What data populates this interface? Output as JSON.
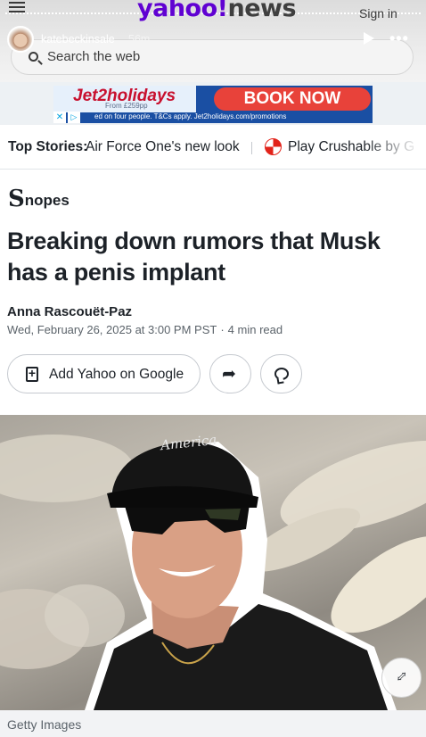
{
  "header": {
    "logo_brand": "yahoo!",
    "logo_section": "news",
    "signin_label": "Sign in"
  },
  "story_overlay": {
    "username": "katebeckinsale",
    "time_ago": "56m"
  },
  "search": {
    "placeholder": "Search the web"
  },
  "ad": {
    "logo_text": "Jet2holidays",
    "price_text": "From £259pp",
    "cta_label": "BOOK NOW",
    "terms_text": "ed on four people. T&Cs apply. Jet2holidays.com/promotions"
  },
  "top_stories": {
    "label": "Top Stories:",
    "items": [
      "Air Force One's new look",
      "Play Crushable by G"
    ]
  },
  "article": {
    "source_glyph": "S",
    "source_word": "nopes",
    "title": "Breaking down rumors that Musk has a penis implant",
    "author": "Anna Rascouët-Paz",
    "date": "Wed, February 26, 2025 at 3:00 PM PST",
    "separator": "·",
    "read_time": "4 min read"
  },
  "actions": {
    "google_label": "Add Yahoo on Google"
  },
  "hero": {
    "cap_text": "America",
    "photo_credit": "Getty Images"
  },
  "icons": {
    "hamburger": "hamburger-menu-icon",
    "search": "search-icon",
    "play": "play-icon",
    "more": "more-horizontal-icon",
    "add": "add-bookmark-icon",
    "share": "share-arrow-icon",
    "comment": "comment-bubble-icon",
    "zoom": "expand-icon"
  },
  "colors": {
    "yahoo_purple": "#6001d2",
    "ad_blue": "#1a4fa3",
    "ad_cta_red": "#e8423a",
    "crushable_red": "#e2231a",
    "text_dark": "#1d2228",
    "text_muted": "#5b636a"
  }
}
